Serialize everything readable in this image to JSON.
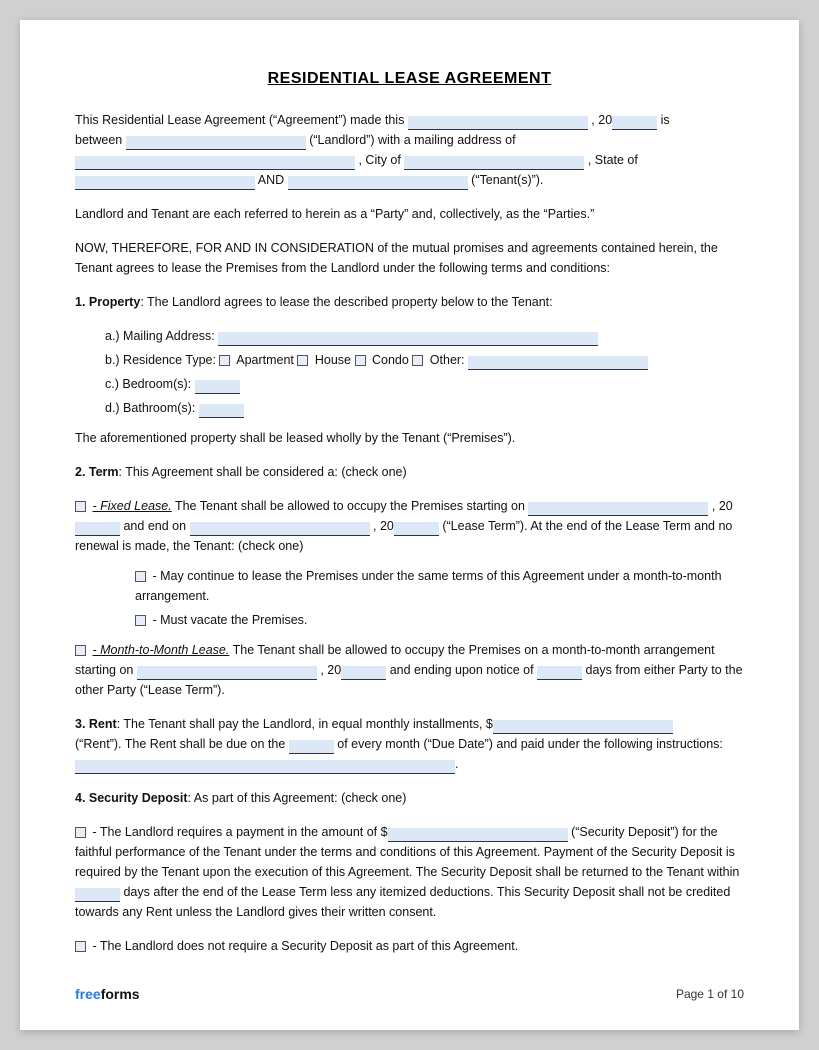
{
  "title": "RESIDENTIAL LEASE AGREEMENT",
  "intro": {
    "line1_a": "This Residential Lease Agreement (“Agreement”) made this",
    "line1_b": ", 20",
    "line1_c": "is",
    "line2_a": "between",
    "line2_b": "(“Landlord”) with a mailing address of",
    "line3_a": ", City of",
    "line3_b": ", State of",
    "line4_a": "AND",
    "line4_b": "(“Tenant(s)”)."
  },
  "parties_paragraph": "Landlord and Tenant are each referred to herein as a “Party” and, collectively, as the “Parties.”",
  "consideration_paragraph": "NOW, THEREFORE, FOR AND IN CONSIDERATION of the mutual promises and agreements contained herein, the Tenant agrees to lease the Premises from the Landlord under the following terms and conditions:",
  "section1": {
    "header": "1. Property",
    "text": ": The Landlord agrees to lease the described property below to the Tenant:",
    "a_label": "a.)  Mailing Address:",
    "b_label": "b.)  Residence Type:",
    "b_apartment": "Apartment",
    "b_house": "House",
    "b_condo": "Condo",
    "b_other": "Other:",
    "c_label": "c.)  Bedroom(s):",
    "d_label": "d.)  Bathroom(s):",
    "footer_text": "The aforementioned property shall be leased wholly by the Tenant (“Premises”)."
  },
  "section2": {
    "header": "2. Term",
    "text": ": This Agreement shall be considered a: (check one)",
    "fixed_lease_label": "- Fixed Lease.",
    "fixed_lease_text1": "The Tenant shall be allowed to occupy the Premises starting on",
    "fixed_lease_text2": ", 20",
    "fixed_lease_text3": "and end on",
    "fixed_lease_text4": ", 20",
    "fixed_lease_text5": "(“Lease Term”). At the end of the Lease Term and no renewal is made, the Tenant: (check one)",
    "option1": "- May continue to lease the Premises under the same terms of this Agreement under a month-to-month arrangement.",
    "option2": "- Must vacate the Premises.",
    "month_label": "- Month-to-Month Lease.",
    "month_text1": "The Tenant shall be allowed to occupy the Premises on a month-to-month arrangement starting on",
    "month_text2": ", 20",
    "month_text3": "and ending upon notice of",
    "month_text4": "days from either Party to the other Party (“Lease Term”)."
  },
  "section3": {
    "header": "3. Rent",
    "text1": ": The Tenant shall pay the Landlord, in equal monthly installments, $",
    "text2": "(“Rent”). The Rent shall be due on the",
    "text3": "of every month (“Due Date”) and paid under the following instructions:",
    "period_end": "."
  },
  "section4": {
    "header": "4. Security Deposit",
    "text": ": As part of this Agreement: (check one)",
    "option1_text1": "- The Landlord requires a payment in the amount of $",
    "option1_text2": "(“Security Deposit”) for the faithful performance of the Tenant under the terms and conditions of this Agreement. Payment of the Security Deposit is required by the Tenant upon the execution of this Agreement. The Security Deposit shall be returned to the Tenant within",
    "option1_text3": "days after the end of the Lease Term less any itemized deductions. This Security Deposit shall not be credited towards any Rent unless the Landlord gives their written consent.",
    "option2_text": "- The Landlord does not require a Security Deposit as part of this Agreement."
  },
  "footer": {
    "brand_free": "free",
    "brand_forms": "forms",
    "page_label": "Page 1 of 10"
  }
}
